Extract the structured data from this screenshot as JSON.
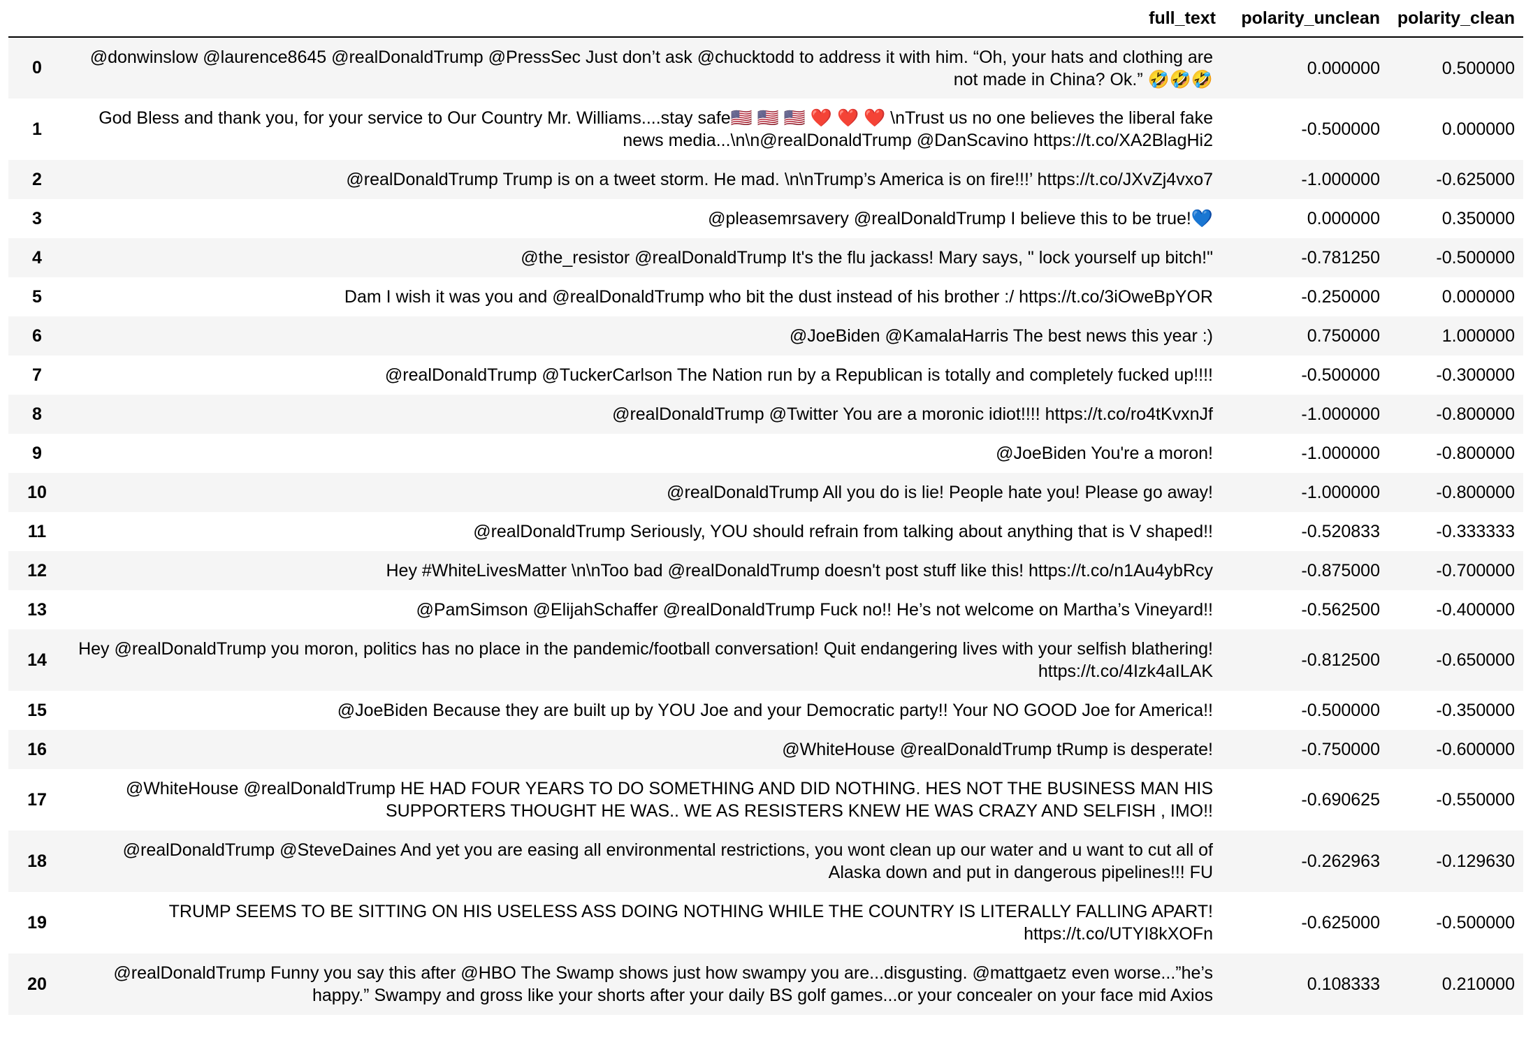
{
  "columns": {
    "index": "",
    "full_text": "full_text",
    "polarity_unclean": "polarity_unclean",
    "polarity_clean": "polarity_clean"
  },
  "rows": [
    {
      "index": "0",
      "full_text": "@donwinslow @laurence8645 @realDonaldTrump @PressSec Just don’t ask @chucktodd to address it with him. “Oh, your hats and clothing are not made in China? Ok.” 🤣🤣🤣",
      "polarity_unclean": "0.000000",
      "polarity_clean": "0.500000"
    },
    {
      "index": "1",
      "full_text": "God Bless and thank you, for your service to Our Country Mr. Williams....stay safe🇺🇸 🇺🇸 🇺🇸 ❤️ ❤️ ❤️ \\nTrust us no one believes the liberal fake news media...\\n\\n@realDonaldTrump @DanScavino https://t.co/XA2BlagHi2",
      "polarity_unclean": "-0.500000",
      "polarity_clean": "0.000000"
    },
    {
      "index": "2",
      "full_text": "@realDonaldTrump Trump is on a tweet storm. He mad. \\n\\nTrump’s America is on fire!!!’ https://t.co/JXvZj4vxo7",
      "polarity_unclean": "-1.000000",
      "polarity_clean": "-0.625000"
    },
    {
      "index": "3",
      "full_text": "@pleasemrsavery @realDonaldTrump I believe this to be true!💙",
      "polarity_unclean": "0.000000",
      "polarity_clean": "0.350000"
    },
    {
      "index": "4",
      "full_text": "@the_resistor @realDonaldTrump It's the flu jackass! Mary says, \" lock yourself up bitch!\"",
      "polarity_unclean": "-0.781250",
      "polarity_clean": "-0.500000"
    },
    {
      "index": "5",
      "full_text": "Dam I wish it was you and @realDonaldTrump who bit the dust instead of his brother :/ https://t.co/3iOweBpYOR",
      "polarity_unclean": "-0.250000",
      "polarity_clean": "0.000000"
    },
    {
      "index": "6",
      "full_text": "@JoeBiden @KamalaHarris The best news this year :)",
      "polarity_unclean": "0.750000",
      "polarity_clean": "1.000000"
    },
    {
      "index": "7",
      "full_text": "@realDonaldTrump @TuckerCarlson The Nation run by a Republican is totally and completely fucked up!!!!",
      "polarity_unclean": "-0.500000",
      "polarity_clean": "-0.300000"
    },
    {
      "index": "8",
      "full_text": "@realDonaldTrump @Twitter You are a moronic idiot!!!! https://t.co/ro4tKvxnJf",
      "polarity_unclean": "-1.000000",
      "polarity_clean": "-0.800000"
    },
    {
      "index": "9",
      "full_text": "@JoeBiden You're a moron!",
      "polarity_unclean": "-1.000000",
      "polarity_clean": "-0.800000"
    },
    {
      "index": "10",
      "full_text": "@realDonaldTrump All you do is lie! People hate you! Please go away!",
      "polarity_unclean": "-1.000000",
      "polarity_clean": "-0.800000"
    },
    {
      "index": "11",
      "full_text": "@realDonaldTrump Seriously, YOU should refrain from talking about anything that is V shaped!!",
      "polarity_unclean": "-0.520833",
      "polarity_clean": "-0.333333"
    },
    {
      "index": "12",
      "full_text": "Hey #WhiteLivesMatter \\n\\nToo bad @realDonaldTrump doesn't post stuff like this! https://t.co/n1Au4ybRcy",
      "polarity_unclean": "-0.875000",
      "polarity_clean": "-0.700000"
    },
    {
      "index": "13",
      "full_text": "@PamSimson @ElijahSchaffer @realDonaldTrump Fuck no!! He’s not welcome on Martha’s Vineyard!!",
      "polarity_unclean": "-0.562500",
      "polarity_clean": "-0.400000"
    },
    {
      "index": "14",
      "full_text": "Hey @realDonaldTrump you moron, politics has no place in the pandemic/football conversation! Quit endangering lives with your selfish blathering! https://t.co/4Izk4aILAK",
      "polarity_unclean": "-0.812500",
      "polarity_clean": "-0.650000"
    },
    {
      "index": "15",
      "full_text": "@JoeBiden Because they are built up by YOU Joe and your Democratic party!! Your NO GOOD Joe for America!!",
      "polarity_unclean": "-0.500000",
      "polarity_clean": "-0.350000"
    },
    {
      "index": "16",
      "full_text": "@WhiteHouse @realDonaldTrump tRump is desperate!",
      "polarity_unclean": "-0.750000",
      "polarity_clean": "-0.600000"
    },
    {
      "index": "17",
      "full_text": "@WhiteHouse @realDonaldTrump HE HAD FOUR YEARS TO DO SOMETHING AND DID NOTHING. HES NOT THE BUSINESS MAN HIS SUPPORTERS THOUGHT HE WAS.. WE AS RESISTERS KNEW HE WAS CRAZY AND SELFISH , IMO!!",
      "polarity_unclean": "-0.690625",
      "polarity_clean": "-0.550000"
    },
    {
      "index": "18",
      "full_text": "@realDonaldTrump @SteveDaines And yet you are easing all environmental restrictions, you wont clean up our water and u want to cut all of Alaska down and put in dangerous pipelines!!! FU",
      "polarity_unclean": "-0.262963",
      "polarity_clean": "-0.129630"
    },
    {
      "index": "19",
      "full_text": "TRUMP SEEMS TO BE SITTING ON HIS USELESS ASS DOING NOTHING WHILE THE COUNTRY IS LITERALLY FALLING APART! https://t.co/UTYI8kXOFn",
      "polarity_unclean": "-0.625000",
      "polarity_clean": "-0.500000"
    },
    {
      "index": "20",
      "full_text": "@realDonaldTrump Funny you say this after @HBO The Swamp shows just how swampy you are...disgusting. @mattgaetz even worse...”he’s happy.” Swampy and gross like your shorts after your daily BS golf games...or your concealer on your face mid Axios",
      "polarity_unclean": "0.108333",
      "polarity_clean": "0.210000"
    }
  ]
}
